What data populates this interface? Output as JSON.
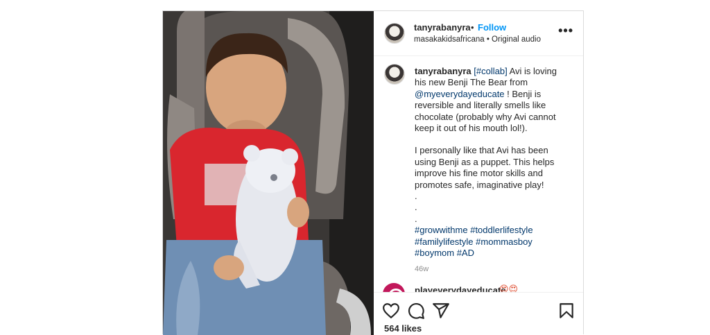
{
  "post": {
    "username": "tanyrabanyra",
    "separator": "•",
    "follow_label": "Follow",
    "audio_line": "masakakidsafricana • Original audio",
    "more_label": "•••"
  },
  "caption": {
    "username": "tanyrabanyra",
    "collab_tag": "[#collab]",
    "text_1": " Avi is loving his new Benji The Bear from ",
    "mention": "@myeverydayeducate",
    "text_2": " ! Benji is reversible and literally smells like chocolate (probably why Avi cannot keep it out of his mouth lol!).",
    "para_2": "I personally like that Avi has been using Benji as a puppet. This helps improve his fine motor skills and promotes safe, imaginative play!",
    "dots": [
      ".",
      ".",
      "."
    ],
    "hashtags": [
      "#growwithme",
      "#toddlerlifestyle",
      "#familylifestyle",
      "#mommasboy",
      "#boymom",
      "#AD"
    ],
    "age": "46w"
  },
  "comment": {
    "username": "playeverydayeducate",
    "emoji": "😍😍"
  },
  "actions": {
    "icons": [
      "heart-icon",
      "comment-icon",
      "share-icon",
      "save-icon"
    ],
    "likes": "564 likes"
  },
  "colors": {
    "link": "#00376b",
    "follow": "#0095f6",
    "shirt": "#d9262e"
  }
}
